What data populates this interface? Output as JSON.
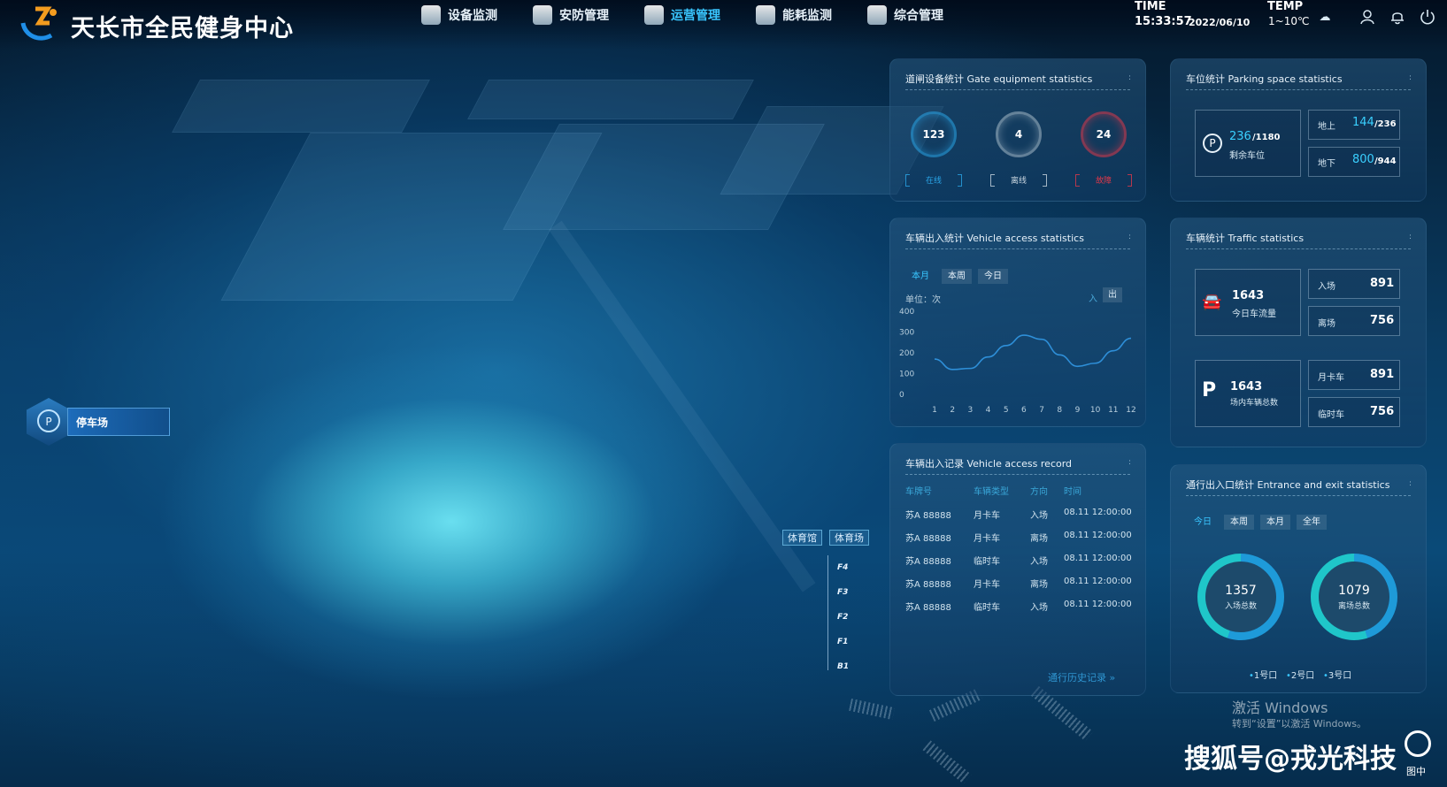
{
  "header": {
    "brand": "天长市全民健身中心",
    "nav": [
      {
        "label": "设备监测",
        "icon": "monitor-icon"
      },
      {
        "label": "安防管理",
        "icon": "shield-icon"
      },
      {
        "label": "运营管理",
        "icon": "operation-icon",
        "active": true
      },
      {
        "label": "能耗监测",
        "icon": "energy-icon"
      },
      {
        "label": "综合管理",
        "icon": "settings-icon"
      }
    ],
    "time_label": "TIME",
    "time_value": "15:33:57",
    "date_value": "2022/06/10",
    "temp_label": "TEMP",
    "temp_value": "1~10℃"
  },
  "side": {
    "parking_button": "停车场"
  },
  "building": {
    "tag_a": "体育馆",
    "tag_b": "体育场",
    "floors": [
      "F4",
      "F3",
      "F2",
      "F1",
      "B1"
    ]
  },
  "gate": {
    "title": "道闸设备统计 Gate equipment statistics",
    "more": ":",
    "items": [
      {
        "value": "123",
        "label": "在线",
        "color": "#2aa6e8"
      },
      {
        "value": "4",
        "label": "离线",
        "color": "#c9d6e0"
      },
      {
        "value": "24",
        "label": "故障",
        "color": "#e0384a"
      }
    ]
  },
  "parking": {
    "title": "车位统计 Parking space statistics",
    "more": ":",
    "remaining_value": "236",
    "remaining_total": "/1180",
    "remaining_label": "剩余车位",
    "ground_label": "地上",
    "ground_value": "144",
    "ground_total": "/236",
    "under_label": "地下",
    "under_value": "800",
    "under_total": "/944"
  },
  "access": {
    "title": "车辆出入统计 Vehicle access statistics",
    "more": ":",
    "tabs": [
      "本月",
      "本周",
      "今日"
    ],
    "unit": "单位：次",
    "legend_in": "入",
    "legend_out": "出"
  },
  "chart_data": {
    "type": "line",
    "x": [
      "1",
      "2",
      "3",
      "4",
      "5",
      "6",
      "7",
      "8",
      "9",
      "10",
      "11",
      "12"
    ],
    "series": [
      {
        "name": "入",
        "values": [
          170,
          120,
          125,
          180,
          235,
          285,
          265,
          190,
          135,
          150,
          210,
          270
        ]
      }
    ],
    "ylim": [
      0,
      400
    ],
    "yticks": [
      "400",
      "300",
      "200",
      "100",
      "0"
    ],
    "ylabel": "单位：次",
    "grid": false
  },
  "traffic": {
    "title": "车辆统计 Traffic statistics",
    "more": ":",
    "today_value": "1643",
    "today_label": "今日车流量",
    "in_label": "入场",
    "in_value": "891",
    "out_label": "离场",
    "out_value": "756",
    "inside_value": "1643",
    "inside_label": "场内车辆总数",
    "monthly_label": "月卡车",
    "monthly_value": "891",
    "temp_label": "临时车",
    "temp_value": "756"
  },
  "record": {
    "title": "车辆出入记录 Vehicle access record",
    "more": ":",
    "headers": [
      "车牌号",
      "车辆类型",
      "方向",
      "时间"
    ],
    "rows": [
      [
        "苏A 88888",
        "月卡车",
        "入场",
        "08.11 12:00:00"
      ],
      [
        "苏A 88888",
        "月卡车",
        "离场",
        "08.11 12:00:00"
      ],
      [
        "苏A 88888",
        "临时车",
        "入场",
        "08.11 12:00:00"
      ],
      [
        "苏A 88888",
        "月卡车",
        "离场",
        "08.11 12:00:00"
      ],
      [
        "苏A 88888",
        "临时车",
        "入场",
        "08.11 12:00:00"
      ]
    ],
    "history_link": "通行历史记录 »"
  },
  "entrance": {
    "title": "通行出入口统计 Entrance and exit statistics",
    "more": ":",
    "tabs": [
      "今日",
      "本周",
      "本月",
      "全年"
    ],
    "in_total": "1357",
    "in_label": "入场总数",
    "out_total": "1079",
    "out_label": "离场总数",
    "legend": [
      "1号口",
      "2号口",
      "3号口"
    ]
  },
  "watermark": {
    "activate": "激活 Windows",
    "activate_sub": "转到“设置”以激活 Windows。",
    "sohu": "搜狐号@戎光科技",
    "sohu_small": "图中"
  },
  "colors": {
    "accent": "#39c6ff",
    "ring_in": "#1fc6c9",
    "ring_out": "#1e9ad9",
    "alarm": "#e0384a"
  }
}
